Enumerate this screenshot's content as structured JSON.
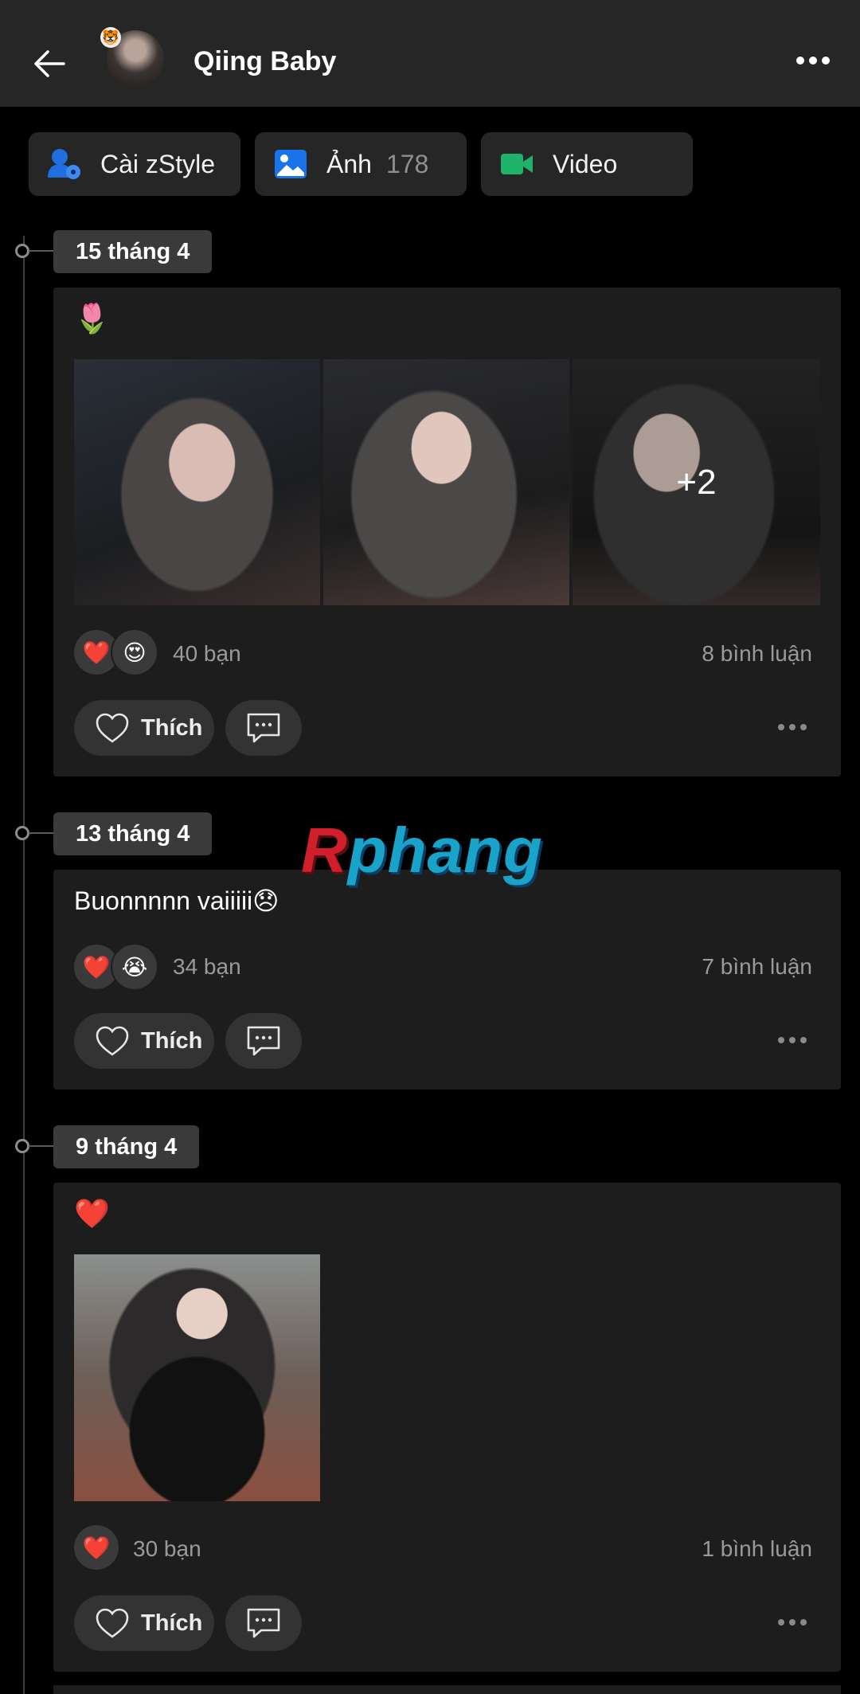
{
  "header": {
    "name": "Qiing Baby"
  },
  "quick_tabs": [
    {
      "label": "Cài zStyle",
      "icon": "zstyle-person-icon",
      "count": ""
    },
    {
      "label": "Ảnh",
      "icon": "photo-icon",
      "count": "178"
    },
    {
      "label": "Video",
      "icon": "video-camera-icon",
      "count": ""
    }
  ],
  "posts": [
    {
      "date": "15 tháng 4",
      "text": "🌷",
      "photos_more": "+2",
      "reactions": [
        "❤️",
        "😍"
      ],
      "reaction_count": "40 bạn",
      "comment_count": "8 bình luận",
      "like_label": "Thích"
    },
    {
      "date": "13 tháng 4",
      "text": "Buonnnnn vaiiiii😞",
      "reactions": [
        "❤️",
        "😭"
      ],
      "reaction_count": "34 bạn",
      "comment_count": "7 bình luận",
      "like_label": "Thích"
    },
    {
      "date": "9 tháng 4",
      "text": "❤️",
      "reactions": [
        "❤️"
      ],
      "reaction_count": "30 bạn",
      "comment_count": "1 bình luận",
      "like_label": "Thích"
    }
  ],
  "watermark": {
    "first": "R",
    "rest": "phang"
  },
  "colors": {
    "background": "#000000",
    "header": "#262626",
    "card": "#1d1d1d",
    "zstyle": "#1f6fe0",
    "photo": "#1a73e8",
    "video": "#1fb36a"
  }
}
